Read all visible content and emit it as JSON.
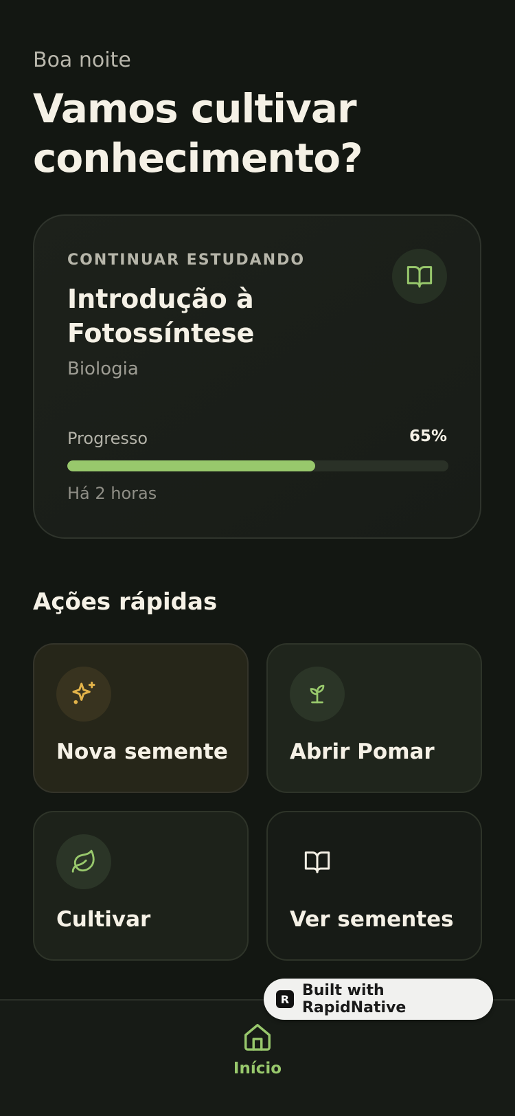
{
  "header": {
    "greeting": "Boa noite",
    "headline": "Vamos cultivar conhecimento?"
  },
  "continue_card": {
    "eyebrow": "CONTINUAR ESTUDANDO",
    "title": "Introdução à Fotossíntese",
    "subject": "Biologia",
    "progress_label": "Progresso",
    "progress_value": "65%",
    "progress_fraction": 0.65,
    "last_studied": "Há 2 horas",
    "icon": "open-book-icon"
  },
  "quick_actions": {
    "title": "Ações rápidas",
    "items": [
      {
        "label": "Nova semente",
        "icon": "sparkles-icon"
      },
      {
        "label": "Abrir Pomar",
        "icon": "sprout-icon"
      },
      {
        "label": "Cultivar",
        "icon": "leaf-icon"
      },
      {
        "label": "Ver sementes",
        "icon": "book-icon"
      }
    ]
  },
  "tabbar": {
    "items": [
      {
        "label": "Início",
        "icon": "home-icon",
        "active": true
      }
    ]
  },
  "badge": {
    "label": "Built with RapidNative"
  },
  "colors": {
    "background": "#131712",
    "accent_green": "#98c86c",
    "accent_gold": "#e2b34a",
    "text_primary": "#f5f1e6"
  }
}
